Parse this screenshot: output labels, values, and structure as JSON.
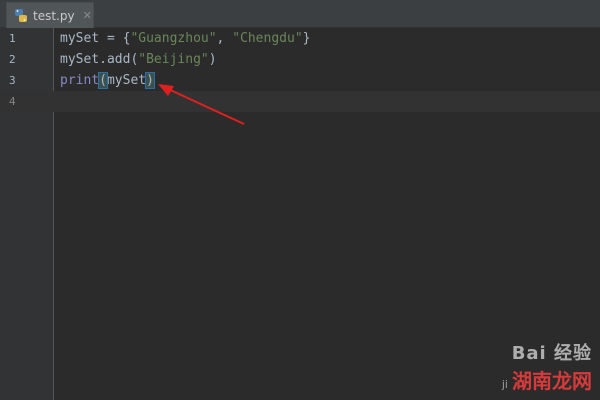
{
  "tab": {
    "filename": "test.py",
    "close_glyph": "✕",
    "icon": "python-file-icon"
  },
  "line_numbers": [
    "1",
    "2",
    "3",
    "4"
  ],
  "code": {
    "line1": {
      "var": "mySet",
      "eq": " = {",
      "s1": "\"Guangzhou\"",
      "comma": ", ",
      "s2": "\"Chengdu\"",
      "close": "}"
    },
    "line2": {
      "obj": "mySet.",
      "method": "add",
      "open": "(",
      "s1": "\"Beijing\"",
      "close": ")"
    },
    "line3": {
      "fn": "print",
      "open": "(",
      "arg": "mySet",
      "close": ")"
    }
  },
  "annotation": {
    "type": "red-arrow",
    "color": "#e02020"
  },
  "watermark": {
    "top": "Bai 经验",
    "small": "ji",
    "bottom": "湖南龙网"
  },
  "colors": {
    "background": "#2b2b2b",
    "gutter": "#313335",
    "string": "#6a8759",
    "builtin": "#8888c6"
  }
}
